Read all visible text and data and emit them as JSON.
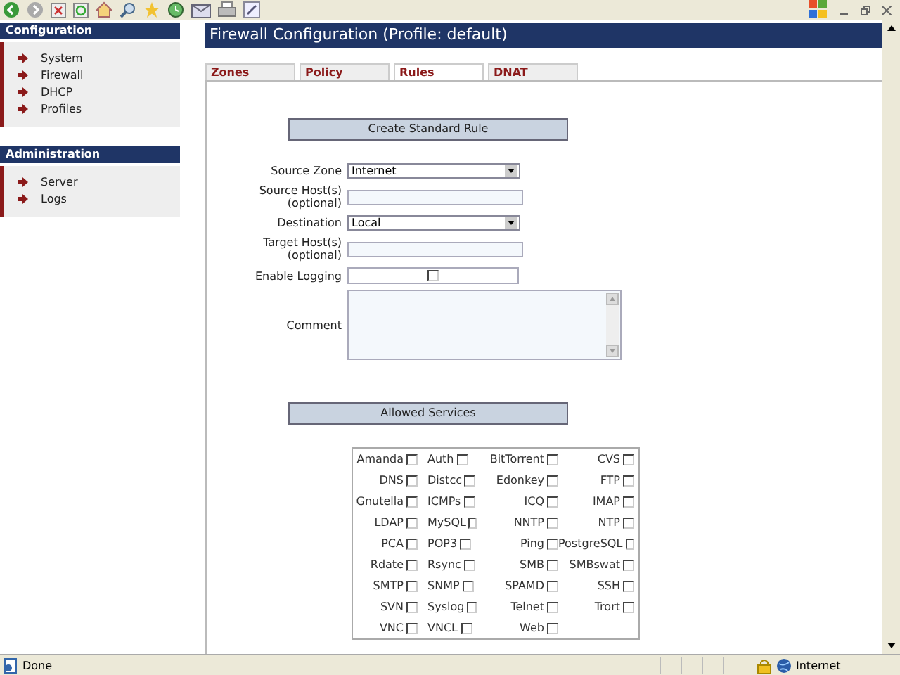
{
  "sidebar": [
    {
      "title": "Configuration",
      "items": [
        "System",
        "Firewall",
        "DHCP",
        "Profiles"
      ]
    },
    {
      "title": "Administration",
      "items": [
        "Server",
        "Logs"
      ]
    }
  ],
  "page_title": "Firewall Configuration (Profile: default)",
  "tabs": [
    {
      "label": "Zones",
      "selected": false
    },
    {
      "label": "Policy",
      "selected": false
    },
    {
      "label": "Rules",
      "selected": true
    },
    {
      "label": "DNAT",
      "selected": false
    }
  ],
  "create_header": "Create Standard Rule",
  "form": [
    {
      "kind": "select",
      "label": "Source Zone",
      "value": "Internet"
    },
    {
      "kind": "text",
      "label": "Source Host(s)",
      "sublabel": "(optional)"
    },
    {
      "kind": "select",
      "label": "Destination",
      "value": "Local"
    },
    {
      "kind": "text",
      "label": "Target Host(s)",
      "sublabel": "(optional)"
    },
    {
      "kind": "checkbox",
      "label": "Enable Logging",
      "checked": false
    },
    {
      "kind": "textarea",
      "label": "Comment"
    }
  ],
  "services_header": "Allowed Services",
  "services": [
    {
      "name": "Amanda",
      "checked": false
    },
    {
      "name": "Auth",
      "checked": false
    },
    {
      "name": "BitTorrent",
      "checked": false
    },
    {
      "name": "CVS",
      "checked": false
    },
    {
      "name": "DNS",
      "checked": false
    },
    {
      "name": "Distcc",
      "checked": false
    },
    {
      "name": "Edonkey",
      "checked": false
    },
    {
      "name": "FTP",
      "checked": false
    },
    {
      "name": "Gnutella",
      "checked": false
    },
    {
      "name": "ICMPs",
      "checked": false
    },
    {
      "name": "ICQ",
      "checked": false
    },
    {
      "name": "IMAP",
      "checked": false
    },
    {
      "name": "LDAP",
      "checked": false
    },
    {
      "name": "MySQL",
      "checked": false
    },
    {
      "name": "NNTP",
      "checked": false
    },
    {
      "name": "NTP",
      "checked": false
    },
    {
      "name": "PCA",
      "checked": false
    },
    {
      "name": "POP3",
      "checked": false
    },
    {
      "name": "Ping",
      "checked": false
    },
    {
      "name": "PostgreSQL",
      "checked": false
    },
    {
      "name": "Rdate",
      "checked": false
    },
    {
      "name": "Rsync",
      "checked": false
    },
    {
      "name": "SMB",
      "checked": false
    },
    {
      "name": "SMBswat",
      "checked": false
    },
    {
      "name": "SMTP",
      "checked": false
    },
    {
      "name": "SNMP",
      "checked": false
    },
    {
      "name": "SPAMD",
      "checked": false
    },
    {
      "name": "SSH",
      "checked": false
    },
    {
      "name": "SVN",
      "checked": false
    },
    {
      "name": "Syslog",
      "checked": false
    },
    {
      "name": "Telnet",
      "checked": false
    },
    {
      "name": "Trort",
      "checked": false
    },
    {
      "name": "VNC",
      "checked": false
    },
    {
      "name": "VNCL",
      "checked": false
    },
    {
      "name": "Web",
      "checked": false
    }
  ],
  "status_bar": {
    "text": "Done",
    "zone": "Internet"
  }
}
